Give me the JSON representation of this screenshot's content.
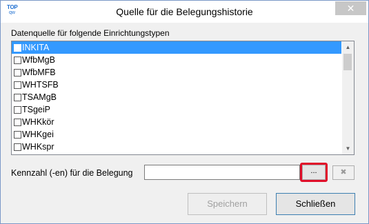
{
  "window": {
    "title": "Quelle für die Belegungshistorie",
    "logo_top": "TOP",
    "logo_sub": "qw",
    "close_glyph": "✕"
  },
  "list": {
    "label": "Datenquelle für folgende Einrichtungstypen",
    "items": [
      {
        "label": "INKITA",
        "selected": true,
        "checked": false
      },
      {
        "label": "WfbMgB",
        "selected": false,
        "checked": false
      },
      {
        "label": "WfbMFB",
        "selected": false,
        "checked": false
      },
      {
        "label": "WHTSFB",
        "selected": false,
        "checked": false
      },
      {
        "label": "TSAMgB",
        "selected": false,
        "checked": false
      },
      {
        "label": "TSgeiP",
        "selected": false,
        "checked": false
      },
      {
        "label": "WHKkör",
        "selected": false,
        "checked": false
      },
      {
        "label": "WHKgei",
        "selected": false,
        "checked": false
      },
      {
        "label": "WHKspr",
        "selected": false,
        "checked": false
      }
    ]
  },
  "kennzahl": {
    "label": "Kennzahl (-en) für die Belegung",
    "value": "",
    "browse_label": "...",
    "clear_glyph": "✖"
  },
  "buttons": {
    "save": "Speichern",
    "close": "Schließen"
  },
  "colors": {
    "selection": "#3399ff",
    "highlight": "#e10f2a"
  },
  "icons": {
    "scroll_up": "▲",
    "scroll_down": "▼"
  }
}
